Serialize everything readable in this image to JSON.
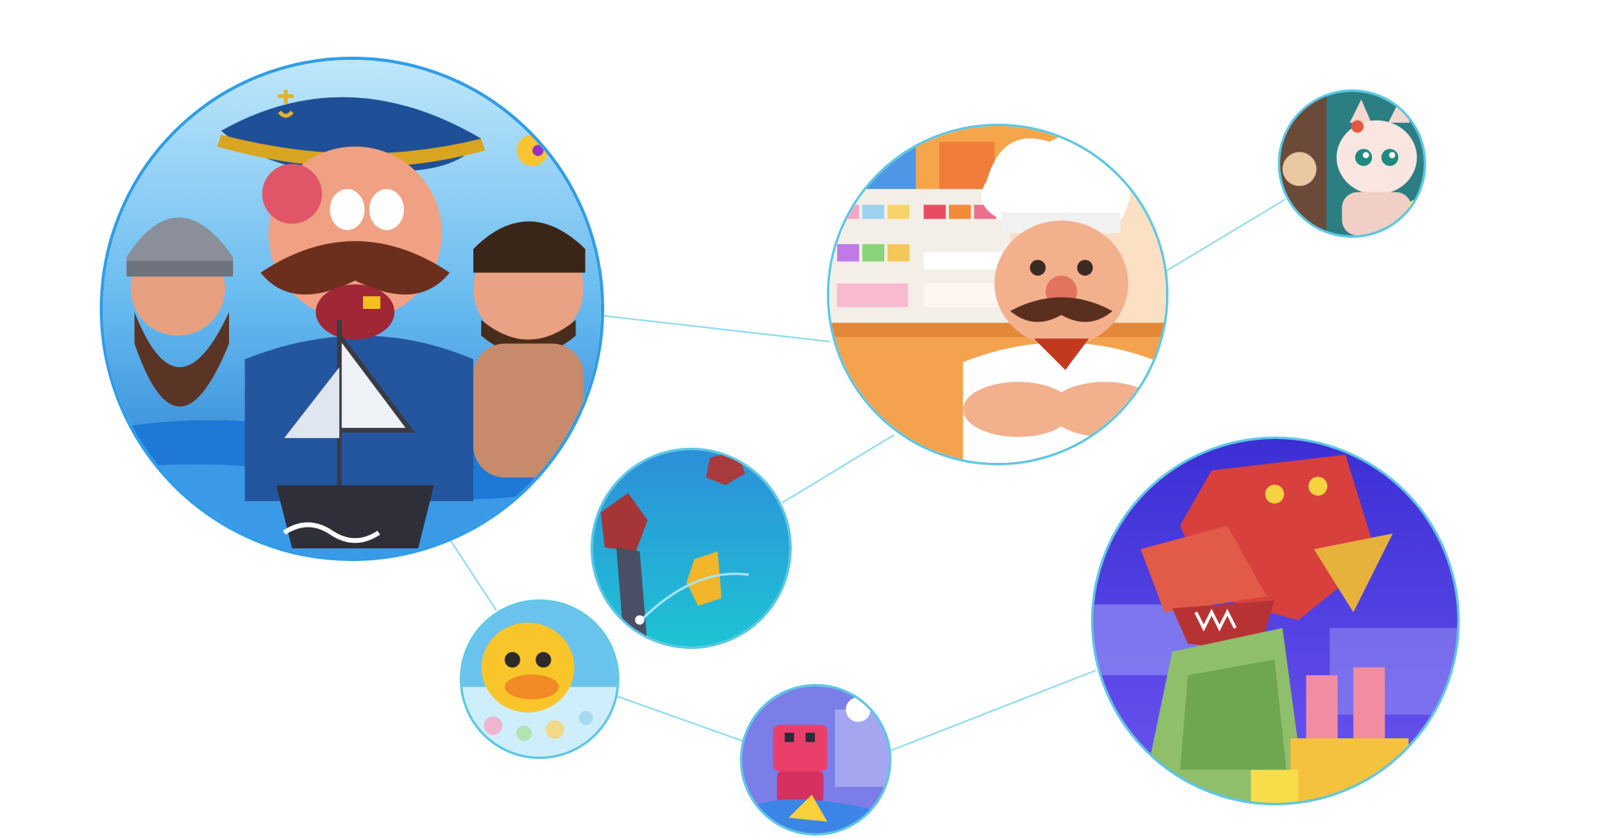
{
  "colors": {
    "connector": "#8fdcef",
    "bubble_border": "#5bc7e6",
    "primary_border": "#2f9de8"
  },
  "bubbles": [
    {
      "name": "pirates-artwork",
      "icon": "pirate-captain-illustration"
    },
    {
      "name": "chef-artwork",
      "icon": "chef-bakery-illustration"
    },
    {
      "name": "cat-artwork",
      "icon": "cartoon-cat-illustration"
    },
    {
      "name": "ocean-artwork",
      "icon": "ocean-rocks-illustration"
    },
    {
      "name": "duck-artwork",
      "icon": "yellow-duck-illustration"
    },
    {
      "name": "robot-artwork",
      "icon": "pink-robot-illustration"
    },
    {
      "name": "dragon-artwork",
      "icon": "voxel-dragon-illustration"
    }
  ]
}
